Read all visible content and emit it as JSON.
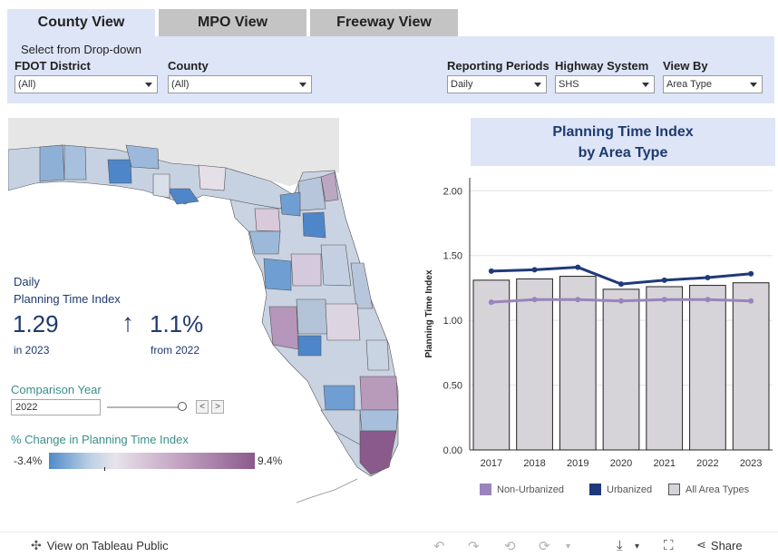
{
  "tabs": [
    {
      "label": "County View",
      "active": true
    },
    {
      "label": "MPO View",
      "active": false
    },
    {
      "label": "Freeway View",
      "active": false
    }
  ],
  "filters": {
    "hint": "Select from Drop-down",
    "district": {
      "label": "FDOT District",
      "value": "(All)"
    },
    "county": {
      "label": "County",
      "value": "(All)"
    },
    "period": {
      "label": "Reporting Periods",
      "value": "Daily"
    },
    "highway": {
      "label": "Highway System",
      "value": "SHS"
    },
    "viewby": {
      "label": "View By",
      "value": "Area Type"
    }
  },
  "kpi": {
    "line1": "Daily",
    "line2": "Planning Time Index",
    "value": "1.29",
    "value_sub": "in 2023",
    "change_arrow": "↑",
    "change": "1.1%",
    "change_sub": "from 2022"
  },
  "comparison": {
    "title": "Comparison Year",
    "value": "2022",
    "prev": "<",
    "next": ">"
  },
  "change_legend": {
    "title": "% Change in Planning Time Index",
    "min": "-3.4%",
    "max": "9.4%"
  },
  "chart_title": {
    "line1": "Planning Time Index",
    "line2": "by Area Type"
  },
  "chart_data": {
    "type": "bar",
    "categories": [
      "2017",
      "2018",
      "2019",
      "2020",
      "2021",
      "2022",
      "2023"
    ],
    "ylabel": "Planning Time Index",
    "ylim": [
      0,
      2.1
    ],
    "yticks": [
      "0.00",
      "0.50",
      "1.00",
      "1.50",
      "2.00"
    ],
    "series": [
      {
        "name": "All Area Types",
        "kind": "bar",
        "color": "#d6d3d9",
        "values": [
          1.31,
          1.32,
          1.34,
          1.24,
          1.26,
          1.27,
          1.29
        ]
      },
      {
        "name": "Urbanized",
        "kind": "line",
        "color": "#1f3a7a",
        "values": [
          1.38,
          1.39,
          1.41,
          1.28,
          1.31,
          1.33,
          1.36
        ]
      },
      {
        "name": "Non-Urbanized",
        "kind": "line",
        "color": "#9a84bb",
        "values": [
          1.14,
          1.16,
          1.16,
          1.15,
          1.16,
          1.16,
          1.15
        ]
      }
    ],
    "legend_position": "bottom"
  },
  "legend": [
    {
      "label": "Non-Urbanized",
      "color": "#9a84bb"
    },
    {
      "label": "Urbanized",
      "color": "#1f3a7a"
    },
    {
      "label": "All Area Types",
      "color": "#d6d3d9"
    }
  ],
  "footer": {
    "view_label": "View on Tableau Public",
    "share_label": "Share"
  },
  "colors": {
    "accent_blue": "#1f3a6e",
    "teal_label": "#3a8f8a",
    "panel_bg": "#dde5f7"
  }
}
